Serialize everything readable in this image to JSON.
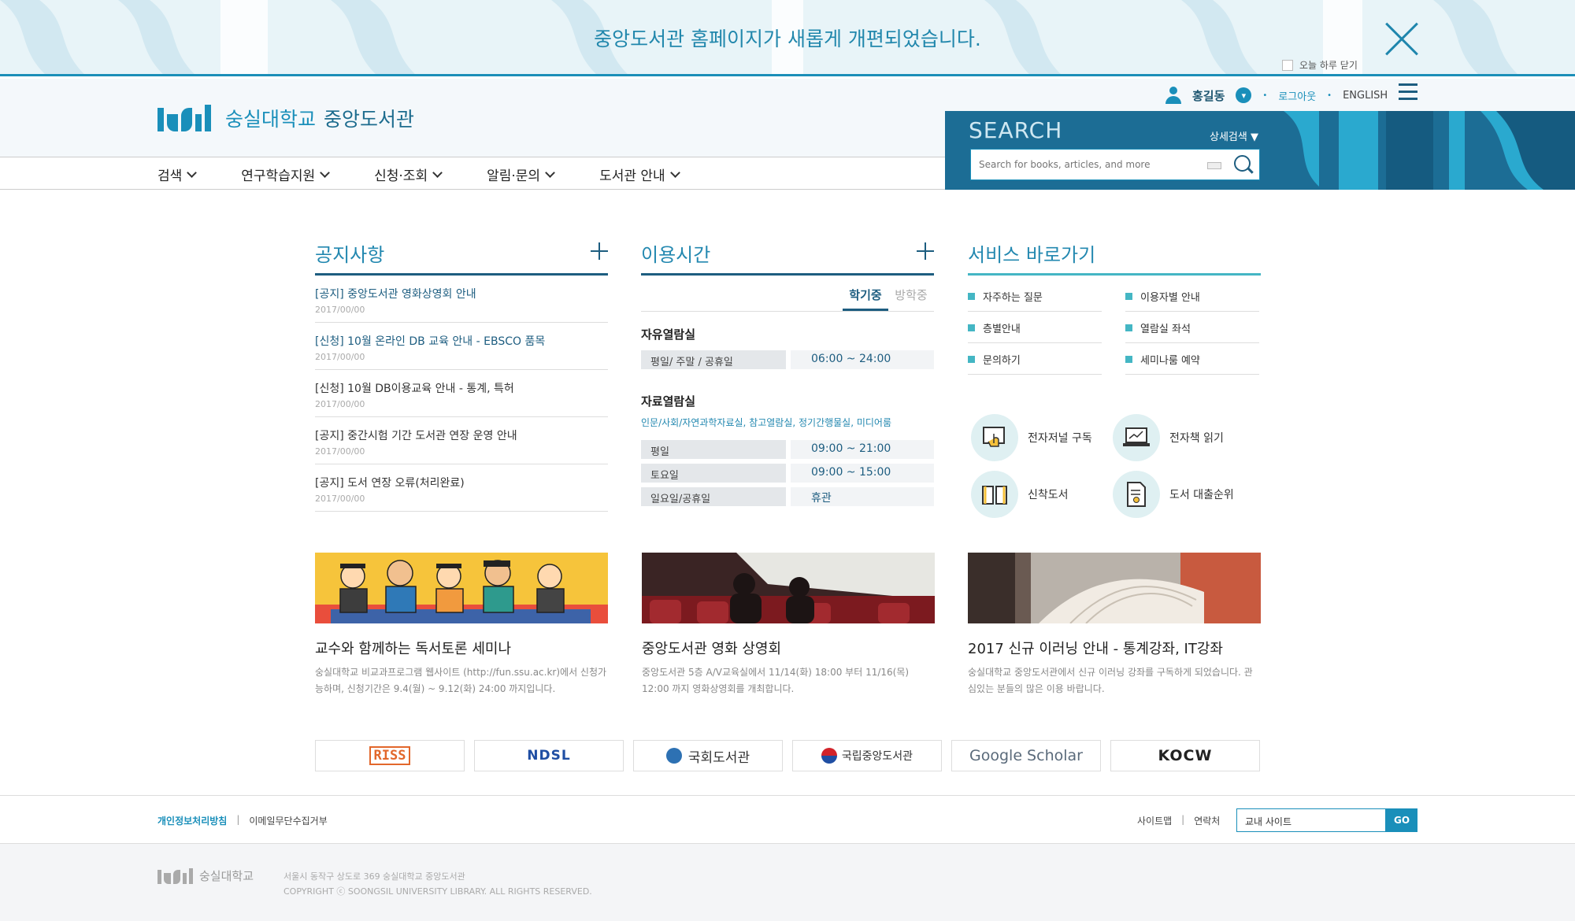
{
  "banner": {
    "message": "중앙도서관 홈페이지가 새롭게 개편되었습니다.",
    "today_close": "오늘 하루 닫기"
  },
  "header": {
    "logo_univ": "숭실대학교",
    "logo_lib": "중앙도서관",
    "user_name": "홍길동",
    "logout": "로그아웃",
    "english": "ENGLISH"
  },
  "nav": [
    "검색",
    "연구학습지원",
    "신청·조회",
    "알림·문의",
    "도서관 안내"
  ],
  "search": {
    "label": "SEARCH",
    "detail": "상세검색 ▼",
    "placeholder": "Search for books, articles, and more"
  },
  "notice": {
    "title": "공지사항",
    "items": [
      {
        "title": "[공지] 중앙도서관 영화상영회 안내",
        "date": "2017/00/00"
      },
      {
        "title": "[신청] 10월 온라인 DB 교육 안내 - EBSCO 품목",
        "date": "2017/00/00"
      },
      {
        "title": "[신청] 10월 DB이용교육 안내 - 통계, 특허",
        "date": "2017/00/00"
      },
      {
        "title": "[공지] 중간시험 기간 도서관 연장 운영 안내",
        "date": "2017/00/00"
      },
      {
        "title": "[공지] 도서 연장 오류(처리완료)",
        "date": "2017/00/00"
      }
    ]
  },
  "hours": {
    "title": "이용시간",
    "tabs": [
      "학기중",
      "방학중"
    ],
    "free_room": "자유열람실",
    "free_rows": [
      {
        "k": "평일/ 주말 / 공휴일",
        "v": "06:00 ~ 24:00"
      }
    ],
    "data_room": "자료열람실",
    "data_desc": "인문/사회/자연과학자료실, 참고열람실, 정기간행물실, 미디어룸",
    "data_rows": [
      {
        "k": "평일",
        "v": "09:00 ~ 21:00"
      },
      {
        "k": "토요일",
        "v": "09:00 ~ 15:00"
      },
      {
        "k": "일요일/공휴일",
        "v": "휴관"
      }
    ]
  },
  "services": {
    "title": "서비스 바로가기",
    "links": [
      "자주하는 질문",
      "이용자별 안내",
      "층별안내",
      "열람실 좌석",
      "문의하기",
      "세미나룸 예약"
    ],
    "icons": [
      {
        "label": "전자저널 구독",
        "icon": "touch-screen-icon"
      },
      {
        "label": "전자책 읽기",
        "icon": "laptop-chart-icon"
      },
      {
        "label": "신착도서",
        "icon": "open-book-icon"
      },
      {
        "label": "도서 대출순위",
        "icon": "ranking-document-icon"
      }
    ]
  },
  "cards": [
    {
      "title": "교수와 함께하는 독서토론 세미나",
      "desc": "숭실대학교 비교과프로그램 웹사이트 (http://fun.ssu.ac.kr)에서 신청가능하며, 신청기간은 9.4(월) ~ 9.12(화) 24:00 까지입니다."
    },
    {
      "title": "중앙도서관 영화 상영회",
      "desc": "중앙도서관 5층 A/V교육실에서 11/14(화) 18:00 부터 11/16(목) 12:00 까지 영화상영회를 개최합니다."
    },
    {
      "title": "2017 신규 이러닝 안내 - 통계강좌, IT강좌",
      "desc": "숭실대학교 중앙도서관에서 신규 이러닝 강좌를 구독하게 되었습니다. 관심있는 분들의 많은 이용 바랍니다."
    }
  ],
  "partners": [
    "RISS",
    "NDSL",
    "국회도서관",
    "국립중앙도서관",
    "Google Scholar",
    "KOCW"
  ],
  "footer": {
    "privacy": "개인정보처리방침",
    "email": "이메일무단수집거부",
    "sitemap": "사이트맵",
    "contact": "연락처",
    "site_select": "교내 사이트",
    "go": "GO",
    "logo": "숭실대학교",
    "address": "서울시 동작구 상도로 369  숭실대학교 중앙도서관",
    "copyright": "COPYRIGHT  ⓒ  SOONGSIL UNIVERSITY LIBRARY. ALL RIGHTS RESERVED."
  },
  "colors": {
    "primary": "#1a8fba",
    "dark": "#1d5d80",
    "teal": "#44b6c4"
  }
}
